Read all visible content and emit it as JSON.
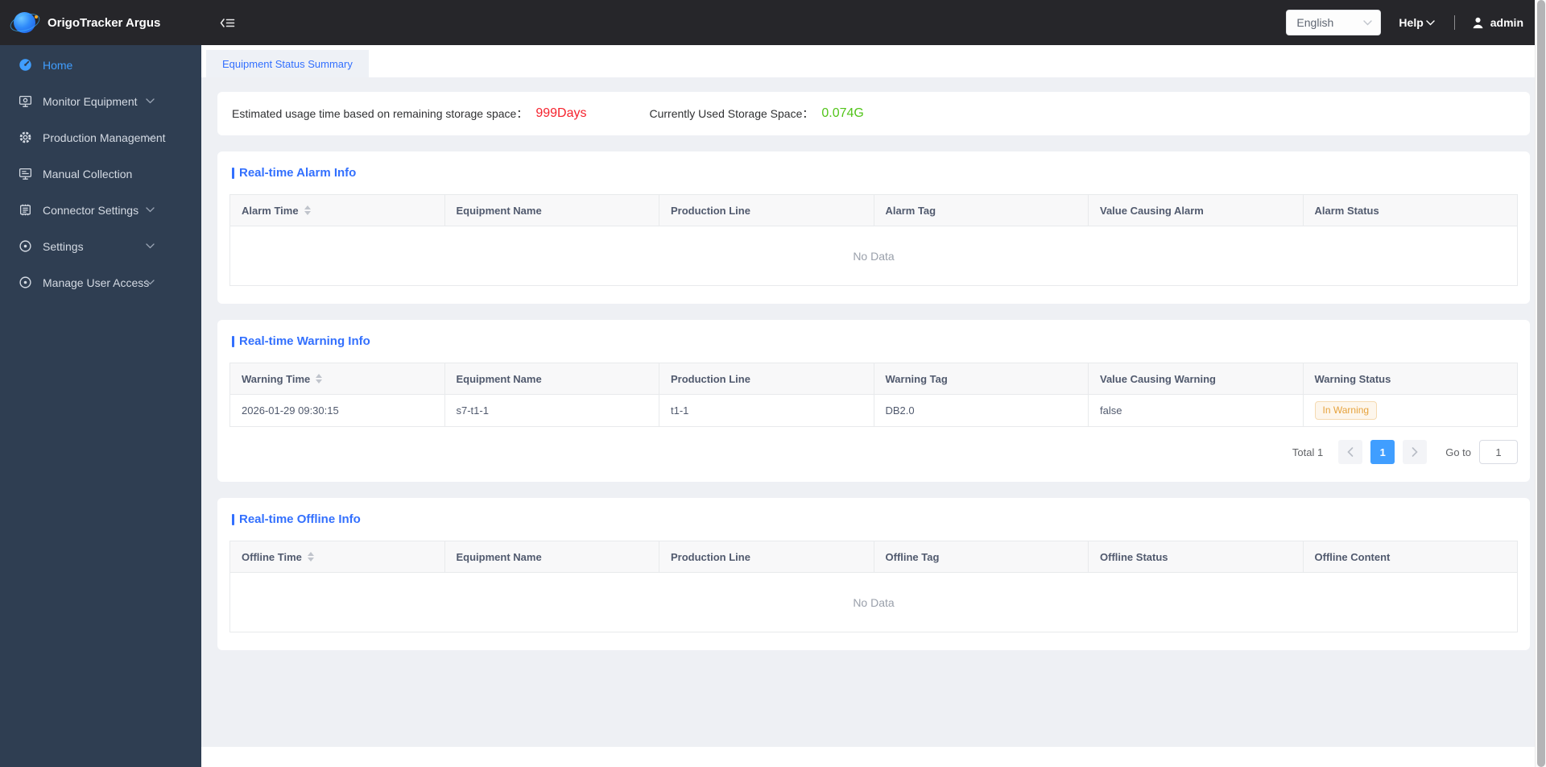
{
  "topbar": {
    "app_title": "OrigoTracker Argus",
    "language": "English",
    "help_label": "Help",
    "username": "admin"
  },
  "sidebar": {
    "items": [
      {
        "label": "Home",
        "icon": "dashboard-icon",
        "active": true,
        "expandable": false
      },
      {
        "label": "Monitor Equipment",
        "icon": "monitor-icon",
        "active": false,
        "expandable": true
      },
      {
        "label": "Production Management",
        "icon": "gear-icon",
        "active": false,
        "expandable": true
      },
      {
        "label": "Manual Collection",
        "icon": "collection-monitor-icon",
        "active": false,
        "expandable": false
      },
      {
        "label": "Connector Settings",
        "icon": "chip-icon",
        "active": false,
        "expandable": true
      },
      {
        "label": "Settings",
        "icon": "circle-dot-icon",
        "active": false,
        "expandable": true
      },
      {
        "label": "Manage User Access",
        "icon": "circle-dot-icon",
        "active": false,
        "expandable": true
      }
    ]
  },
  "tabs": [
    {
      "label": "Equipment Status Summary",
      "active": true
    }
  ],
  "storage": {
    "usage_label": "Estimated usage time based on remaining storage space：",
    "usage_value": "999Days",
    "used_label": "Currently Used Storage Space：",
    "used_value": "0.074G"
  },
  "alarm_section": {
    "title": "Real-time Alarm Info",
    "columns": [
      "Alarm Time",
      "Equipment Name",
      "Production Line",
      "Alarm Tag",
      "Value Causing Alarm",
      "Alarm Status"
    ],
    "empty_text": "No Data"
  },
  "warning_section": {
    "title": "Real-time Warning Info",
    "columns": [
      "Warning Time",
      "Equipment Name",
      "Production Line",
      "Warning Tag",
      "Value Causing Warning",
      "Warning Status"
    ],
    "rows": [
      {
        "time": "2026-01-29 09:30:15",
        "equipment": "s7-t1-1",
        "line": "t1-1",
        "tag": "DB2.0",
        "value": "false",
        "status": "In Warning"
      }
    ],
    "pagination": {
      "total_label": "Total 1",
      "current_page": "1",
      "goto_label": "Go to",
      "goto_value": "1"
    }
  },
  "offline_section": {
    "title": "Real-time Offline Info",
    "columns": [
      "Offline Time",
      "Equipment Name",
      "Production Line",
      "Offline Tag",
      "Offline Status",
      "Offline Content"
    ],
    "empty_text": "No Data"
  },
  "colors": {
    "accent_blue": "#3370fe",
    "pager_active_blue": "#409eff",
    "alarm_red": "#f5222d",
    "storage_green": "#52c41a",
    "warning_badge_text": "#e6a23c",
    "warning_badge_bg": "#fdf6ec",
    "sidebar_bg": "#2f3e52",
    "topbar_bg": "#26262a"
  }
}
